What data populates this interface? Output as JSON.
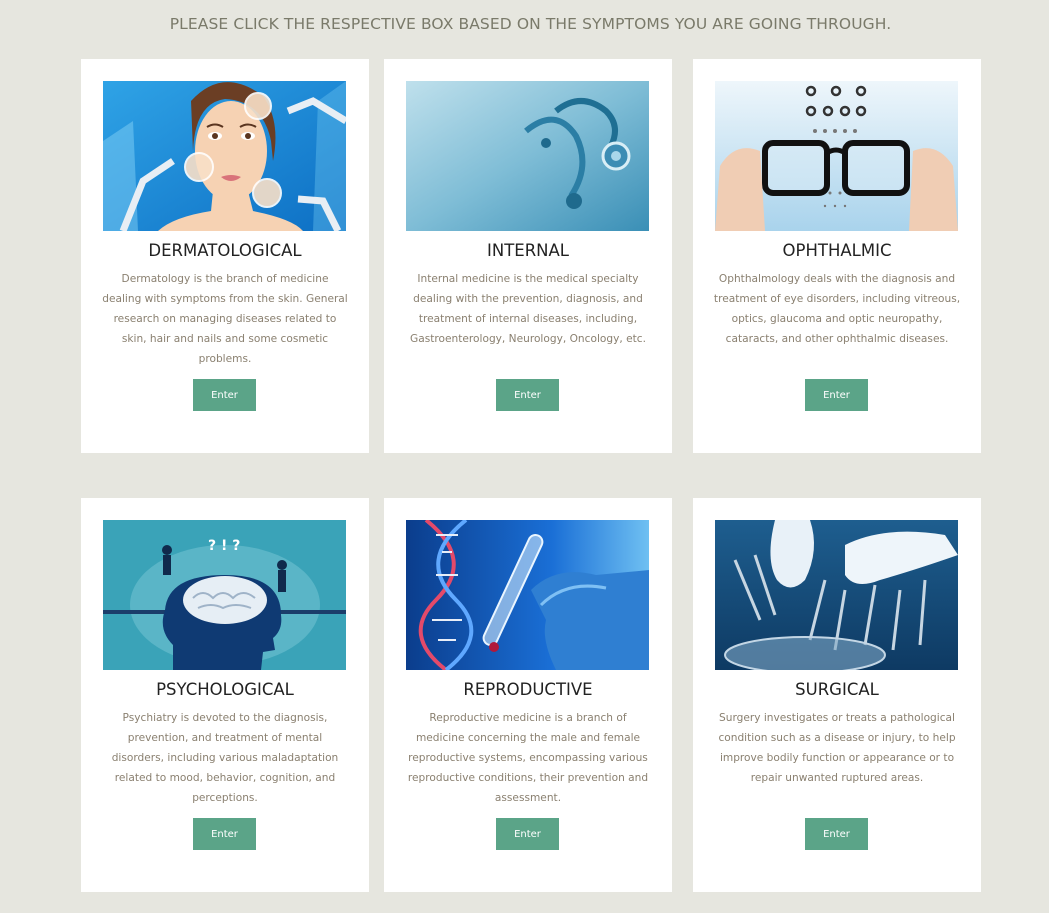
{
  "header": {
    "instruction": "PLEASE CLICK THE RESPECTIVE BOX BASED ON THE SYMPTOMS YOU ARE GOING THROUGH."
  },
  "theme": {
    "background": "#e6e6df",
    "card_background": "#ffffff",
    "button_color": "#5ba488",
    "title_color": "#222222",
    "text_color": "#8a8070"
  },
  "cards": [
    {
      "title": "DERMATOLOGICAL",
      "description": "Dermatology is the branch of medicine dealing with symptoms from the skin. General research on managing diseases related to skin, hair and nails and some cosmetic problems.",
      "button_label": "Enter",
      "image": "dermatology-illustration"
    },
    {
      "title": "INTERNAL",
      "description": "Internal medicine is the medical specialty dealing with the prevention, diagnosis, and treatment of internal diseases, including, Gastroenterology, Neurology, Oncology, etc.",
      "button_label": "Enter",
      "image": "stethoscope-photo"
    },
    {
      "title": "OPHTHALMIC",
      "description": "Ophthalmology deals with the diagnosis and treatment of eye disorders, including vitreous, optics, glaucoma and optic neuropathy, cataracts, and other ophthalmic diseases.",
      "button_label": "Enter",
      "image": "eyeglasses-eye-chart-photo"
    },
    {
      "title": "PSYCHOLOGICAL",
      "description": "Psychiatry is devoted to the diagnosis, prevention, and treatment of mental disorders, including various maladaptation related to mood, behavior, cognition, and perceptions.",
      "button_label": "Enter",
      "image": "brain-head-illustration"
    },
    {
      "title": "REPRODUCTIVE",
      "description": "Reproductive medicine is a branch of medicine concerning the male and female reproductive systems, encompassing various reproductive conditions, their prevention and assessment.",
      "button_label": "Enter",
      "image": "dna-test-tube-photo"
    },
    {
      "title": "SURGICAL",
      "description": "Surgery investigates or treats a pathological condition such as a disease or injury, to help improve bodily function or appearance or to repair unwanted ruptured areas.",
      "button_label": "Enter",
      "image": "surgical-instruments-photo"
    }
  ]
}
